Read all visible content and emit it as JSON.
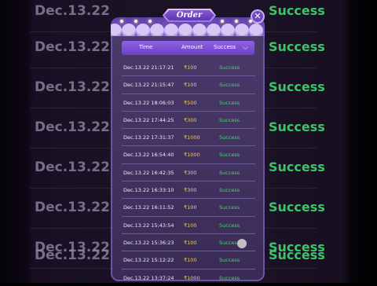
{
  "modal": {
    "title": "Order",
    "close_label": "✕",
    "columns": {
      "time": "Time",
      "amount": "Amount",
      "status": "Success",
      "chevron": "⌵"
    },
    "rows": [
      {
        "time": "Dec.13.22 21:17:21",
        "amount": "₹100",
        "status": "Success"
      },
      {
        "time": "Dec.13.22 21:15:47",
        "amount": "₹100",
        "status": "Success"
      },
      {
        "time": "Dec.13.22 18:06:03",
        "amount": "₹500",
        "status": "Success"
      },
      {
        "time": "Dec.13.22 17:44:25",
        "amount": "₹300",
        "status": "Success"
      },
      {
        "time": "Dec.13.22 17:31:37",
        "amount": "₹1000",
        "status": "Success"
      },
      {
        "time": "Dec.13.22 16:54:40",
        "amount": "₹1000",
        "status": "Success"
      },
      {
        "time": "Dec.13.22 16:42:35",
        "amount": "₹300",
        "status": "Success"
      },
      {
        "time": "Dec.13.22 16:33:10",
        "amount": "₹300",
        "status": "Success"
      },
      {
        "time": "Dec.13.22 16:11:52",
        "amount": "₹100",
        "status": "Success"
      },
      {
        "time": "Dec.13.22 15:43:54",
        "amount": "₹100",
        "status": "Success"
      },
      {
        "time": "Dec.13.22 15:36:23",
        "amount": "₹100",
        "status": "Success"
      },
      {
        "time": "Dec.13.22 15:12:22",
        "amount": "₹100",
        "status": "Success"
      },
      {
        "time": "Dec.13.22 13:37:24",
        "amount": "₹1000",
        "status": "Success"
      }
    ]
  },
  "background_list": [
    {
      "date": "Dec.13.22",
      "status": "Success"
    },
    {
      "date": "Dec.13.22 18",
      "status": "Success"
    },
    {
      "date": "Dec.13.22 17",
      "status": "Success"
    },
    {
      "date": "Dec.13.22 17",
      "status": "Success"
    },
    {
      "date": "Dec.13.22 16",
      "status": "Success"
    },
    {
      "date": "Dec.13.22 16",
      "status": "Success"
    },
    {
      "date": "Dec.13.22 1e",
      "status": "Success"
    },
    {
      "date": "Dec.13.22 1e",
      "status": "Success"
    }
  ],
  "colors": {
    "accent": "#7b4fd6",
    "success": "#4ed277",
    "amount": "#f6c94a"
  }
}
